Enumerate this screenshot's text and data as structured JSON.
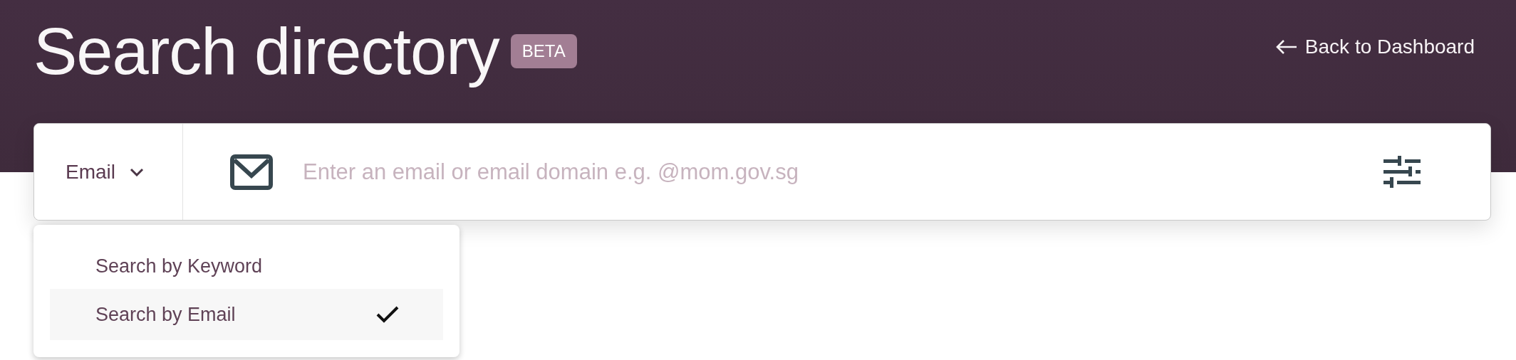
{
  "header": {
    "title": "Search directory",
    "badge": "BETA",
    "back_link": "Back to Dashboard"
  },
  "search": {
    "mode": "Email",
    "placeholder": "Enter an email or email domain e.g. @mom.gov.sg"
  },
  "mode_menu": {
    "expanded": true,
    "items": [
      {
        "label": "Search by Keyword",
        "selected": false
      },
      {
        "label": "Search by Email",
        "selected": true
      }
    ]
  }
}
